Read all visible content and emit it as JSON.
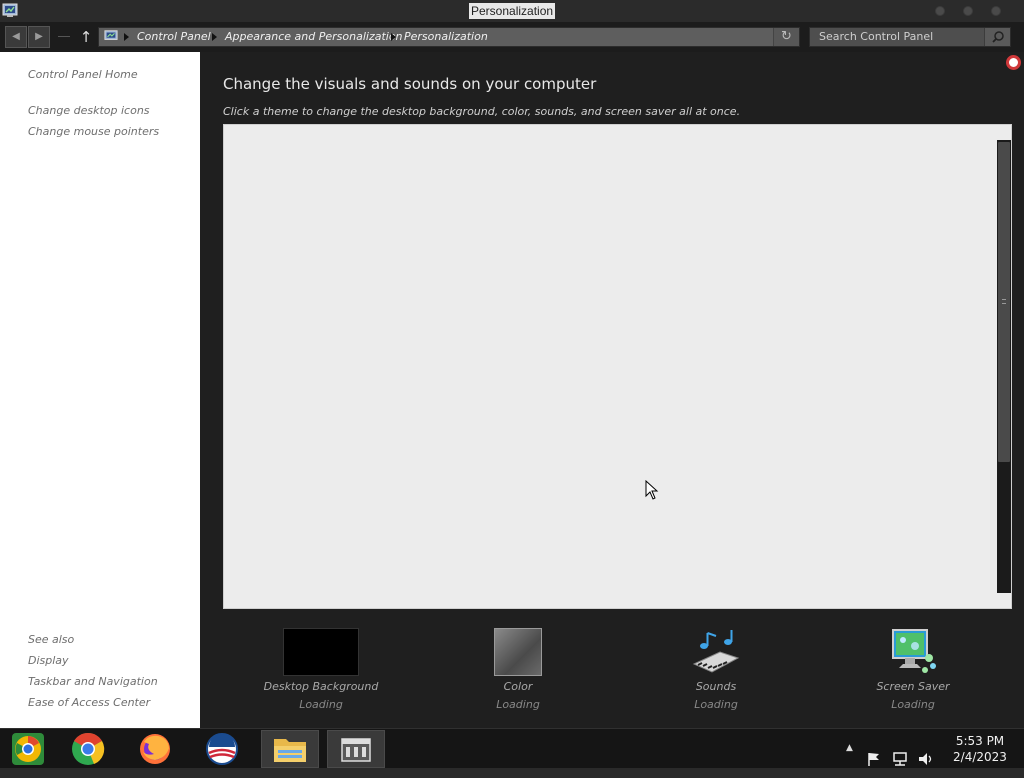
{
  "window": {
    "title": "Personalization"
  },
  "address": {
    "crumbs": [
      "Control Panel",
      "Appearance and Personalization",
      "Personalization"
    ],
    "search_placeholder": "Search Control Panel"
  },
  "left_pane": {
    "home": "Control Panel Home",
    "tasks": [
      "Change desktop icons",
      "Change mouse pointers"
    ],
    "see_also_title": "See also",
    "see_also": [
      "Display",
      "Taskbar and Navigation",
      "Ease of Access Center"
    ]
  },
  "main": {
    "heading": "Change the visuals and sounds on your computer",
    "subheading": "Click a theme to change the desktop background, color, sounds, and screen saver all at once.",
    "settings": [
      {
        "label": "Desktop Background",
        "status": "Loading",
        "icon": "desktop-background-thumbnail"
      },
      {
        "label": "Color",
        "status": "Loading",
        "icon": "color-swatch"
      },
      {
        "label": "Sounds",
        "status": "Loading",
        "icon": "sounds-icon"
      },
      {
        "label": "Screen Saver",
        "status": "Loading",
        "icon": "screen-saver-icon"
      }
    ]
  },
  "taskbar": {
    "apps": [
      "chrome-canary-icon",
      "chrome-icon",
      "firefox-icon",
      "obama-logo-icon",
      "file-explorer-icon",
      "control-panel-icon"
    ],
    "time": "5:53 PM",
    "date": "2/4/2023"
  },
  "colors": {
    "accent_help": "#d0383a",
    "content_bg": "#1f1f1f",
    "theme_list_bg": "#ececec"
  }
}
